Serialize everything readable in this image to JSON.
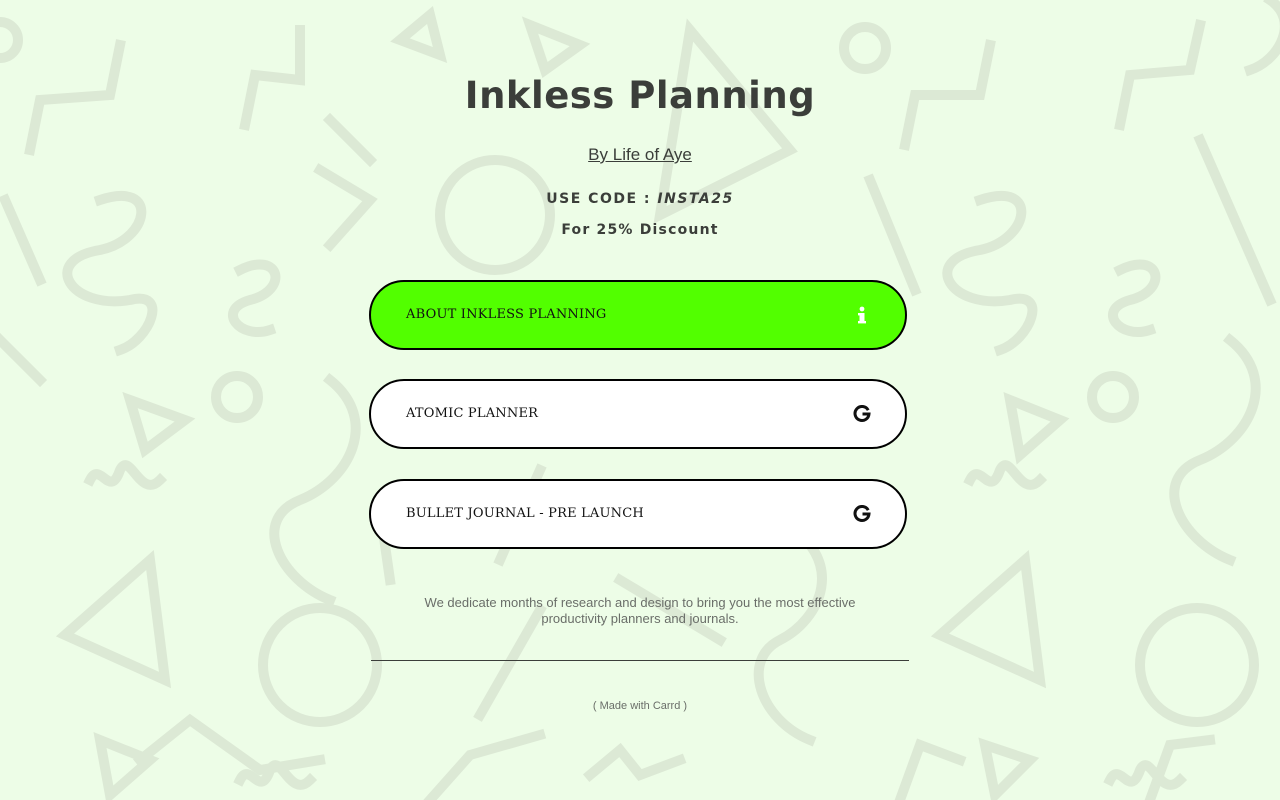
{
  "header": {
    "title": "Inkless Planning",
    "byline": "By Life of Aye",
    "code_prefix": "USE CODE : ",
    "code": "INSTA25",
    "discount": "For 25% Discount"
  },
  "links": [
    {
      "label": "ABOUT INKLESS PLANNING",
      "icon": "info-icon",
      "color": "#52ff00"
    },
    {
      "label": "ATOMIC PLANNER",
      "icon": "gumroad-icon",
      "color": "#ffffff"
    },
    {
      "label": "BULLET JOURNAL - PRE LAUNCH",
      "icon": "gumroad-icon",
      "color": "#ffffff"
    }
  ],
  "description": "We dedicate months of research and design to bring you the most effective productivity planners and journals.",
  "footer": {
    "made_with": "( Made with Carrd )"
  },
  "colors": {
    "background": "#edfde7",
    "pattern": "#dfeed9",
    "accent": "#52ff00",
    "text": "#3b3e3a"
  }
}
